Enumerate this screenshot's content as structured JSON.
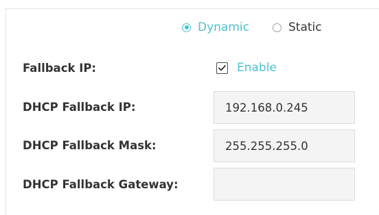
{
  "mode": {
    "options": [
      {
        "label": "Dynamic",
        "selected": true
      },
      {
        "label": "Static",
        "selected": false
      }
    ]
  },
  "fallback_ip": {
    "label": "Fallback IP:",
    "checkbox_label": "Enable",
    "checked": true
  },
  "fields": {
    "dhcp_fallback_ip": {
      "label": "DHCP Fallback IP:",
      "value": "192.168.0.245"
    },
    "dhcp_fallback_mask": {
      "label": "DHCP Fallback Mask:",
      "value": "255.255.255.0"
    },
    "dhcp_fallback_gateway": {
      "label": "DHCP Fallback Gateway:",
      "value": ""
    }
  },
  "colors": {
    "accent": "#4cc1d0",
    "text": "#333333",
    "field_background": "#f4f4f4",
    "field_border": "#dcdcdc"
  }
}
